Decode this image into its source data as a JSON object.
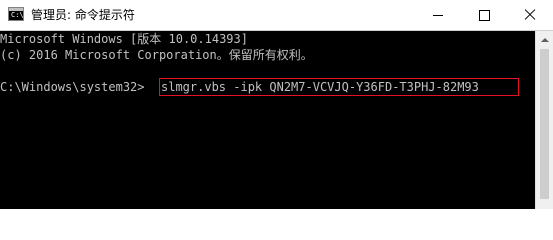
{
  "window": {
    "title": "管理员: 命令提示符",
    "icon": "cmd-icon",
    "app_icon_glyph": "C:\\"
  },
  "controls": {
    "minimize": "minimize-icon",
    "maximize": "maximize-icon",
    "close": "close-icon"
  },
  "console": {
    "lines": [
      "Microsoft Windows [版本 10.0.14393]",
      "(c) 2016 Microsoft Corporation。保留所有权利。",
      "C:\\Windows\\system32>"
    ],
    "command": "slmgr.vbs -ipk QN2M7-VCVJQ-Y36FD-T3PHJ-82M93"
  },
  "colors": {
    "highlight_border": "#e81123",
    "console_bg": "#000000",
    "console_text": "#c0c0c0"
  }
}
